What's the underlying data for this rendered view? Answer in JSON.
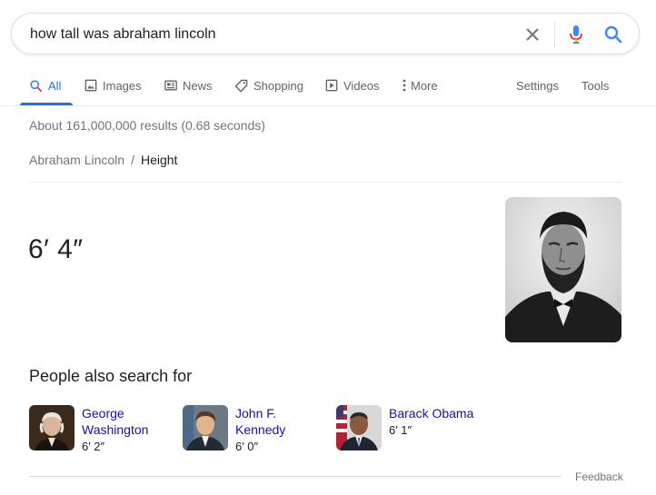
{
  "search": {
    "query": "how tall was abraham lincoln"
  },
  "tabs": {
    "all": "All",
    "images": "Images",
    "news": "News",
    "shopping": "Shopping",
    "videos": "Videos",
    "more": "More",
    "settings": "Settings",
    "tools": "Tools"
  },
  "result_stats": "About 161,000,000 results (0.68 seconds)",
  "breadcrumb": {
    "entity": "Abraham Lincoln",
    "separator": "/",
    "attribute": "Height"
  },
  "answer": "6′ 4″",
  "people_also_search": {
    "title": "People also search for",
    "people": [
      {
        "name_line1": "George",
        "name_line2": "Washington",
        "height": "6′ 2″"
      },
      {
        "name_line1": "John F.",
        "name_line2": "Kennedy",
        "height": "6′ 0″"
      },
      {
        "name_line1": "Barack Obama",
        "name_line2": "",
        "height": "6′ 1″"
      }
    ]
  },
  "feedback": "Feedback",
  "colors": {
    "accent": "#1a73e8",
    "link": "#1a0dab",
    "mic_blue": "#4285f4",
    "mic_red": "#ea4335",
    "mic_yellow": "#fbbc04",
    "mic_green": "#34a853"
  }
}
